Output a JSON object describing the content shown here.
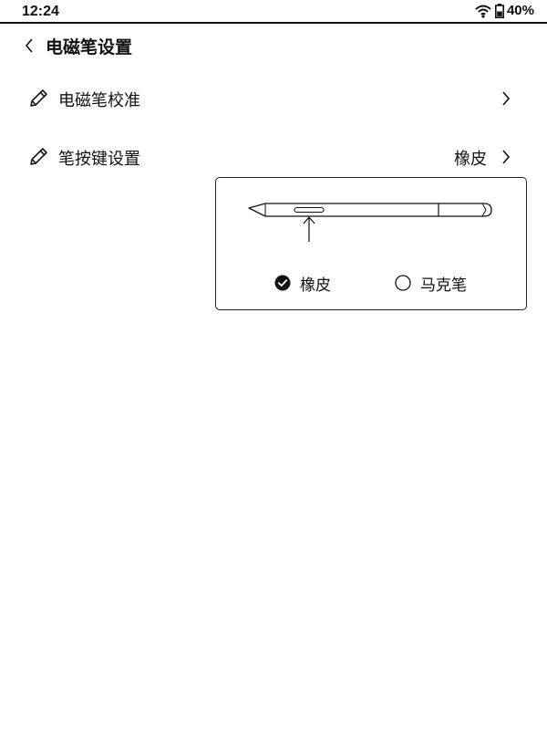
{
  "status": {
    "time": "12:24",
    "battery": "40%"
  },
  "header": {
    "title": "电磁笔设置"
  },
  "rows": {
    "calibrate": {
      "label": "电磁笔校准"
    },
    "pen_button": {
      "label": "笔按键设置",
      "value": "橡皮"
    }
  },
  "pen_button_options": {
    "eraser": {
      "label": "橡皮",
      "selected": true
    },
    "marker": {
      "label": "马克笔",
      "selected": false
    }
  },
  "icons": {
    "back": "chevron-left-icon",
    "edit": "pencil-icon",
    "forward": "chevron-right-icon",
    "wifi": "wifi-icon",
    "battery": "battery-icon"
  }
}
